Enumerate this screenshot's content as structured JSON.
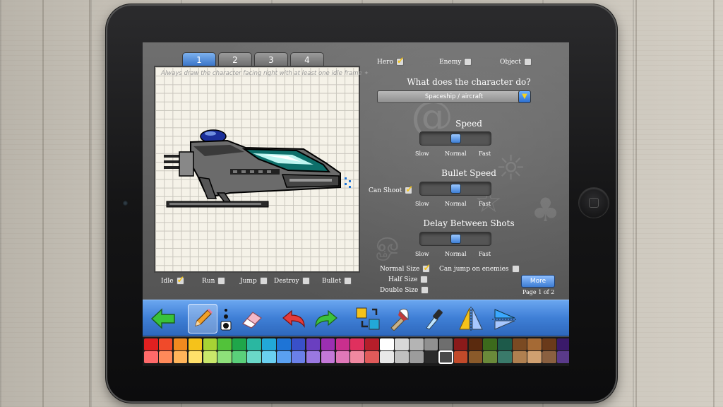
{
  "tabs": [
    "1",
    "2",
    "3",
    "4"
  ],
  "canvas": {
    "hint": "Always draw the character facing right with at least one idle frame ✦"
  },
  "frame_options": [
    {
      "label": "Idle",
      "checked": true
    },
    {
      "label": "Run",
      "checked": false
    },
    {
      "label": "Jump",
      "checked": false
    },
    {
      "label": "Destroy",
      "checked": false
    },
    {
      "label": "Bullet",
      "checked": false
    }
  ],
  "character_type": [
    {
      "label": "Hero",
      "checked": true
    },
    {
      "label": "Enemy",
      "checked": false
    },
    {
      "label": "Object",
      "checked": false
    }
  ],
  "question": "What does the character do?",
  "behavior_select": "Spaceship / aircraft",
  "speed": {
    "title": "Speed",
    "value": 0.5,
    "ticks": [
      "Slow",
      "Normal",
      "Fast"
    ]
  },
  "bullet_speed": {
    "title": "Bullet Speed",
    "value": 0.5,
    "ticks": [
      "Slow",
      "Normal",
      "Fast"
    ]
  },
  "can_shoot": {
    "label": "Can Shoot",
    "checked": true
  },
  "delay": {
    "title": "Delay Between Shots",
    "value": 0.5,
    "ticks": [
      "Slow",
      "Normal",
      "Fast"
    ]
  },
  "size_options": [
    {
      "label": "Normal Size",
      "checked": true
    },
    {
      "label": "Half Size",
      "checked": false
    },
    {
      "label": "Double Size",
      "checked": false
    }
  ],
  "can_jump": {
    "label": "Can jump on enemies",
    "checked": false
  },
  "more_button": "More",
  "page_indicator": "Page 1 of 2",
  "toolbar_tools": [
    "back-arrow-icon",
    "pencil-icon",
    "brush-size-icon",
    "eraser-icon",
    "undo-icon",
    "redo-icon",
    "swap-color-icon",
    "paint-bucket-icon",
    "eyedropper-icon",
    "flip-horizontal-icon",
    "flip-vertical-icon"
  ],
  "palette_row1": [
    "#e02020",
    "#f04a2a",
    "#f08a1f",
    "#f5c21a",
    "#a7d334",
    "#52c23a",
    "#1fa64a",
    "#2ab7a1",
    "#22a8d8",
    "#1e74d6",
    "#3950c9",
    "#6a3fc0",
    "#9b2fb2",
    "#c92f8e",
    "#e0305e",
    "#b51e2a",
    "#ffffff",
    "#d8d8d8",
    "#b4b4b4",
    "#909090",
    "#6e6e6e",
    "#8a1a1a",
    "#5a2a0e",
    "#3c6a1c",
    "#1d5a4a",
    "#7a4a22",
    "#a56a35",
    "#6a3a1a",
    "#3a1a6a"
  ],
  "palette_row2": [
    "#ff6a6a",
    "#ff8a5a",
    "#ffb45a",
    "#ffe06a",
    "#c9e86a",
    "#8ee07a",
    "#5ad07a",
    "#6ad8c8",
    "#6ad0f0",
    "#5aa0f0",
    "#6a80e8",
    "#9a78e0",
    "#c478d8",
    "#e078b8",
    "#f088a0",
    "#e05a5a",
    "#e8e8e8",
    "#c0c0c0",
    "#9c9c9c",
    "#2a2a2a",
    "#4a4a4a",
    "#c24a2a",
    "#8a5a2a",
    "#6a8a3a",
    "#3a7a6a",
    "#b08050",
    "#d0a070",
    "#8a6040",
    "#5a3a8a"
  ],
  "palette_selected_row": 2,
  "palette_selected_col": 20
}
